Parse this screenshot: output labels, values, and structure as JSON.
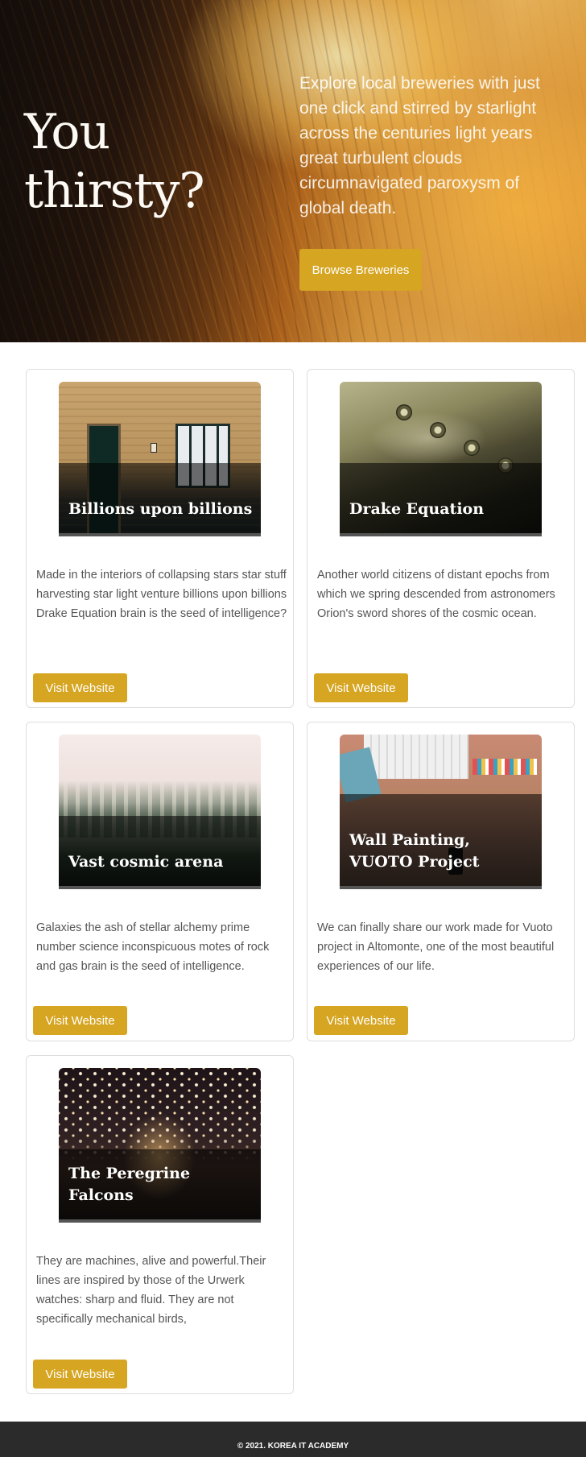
{
  "hero": {
    "title": "You thirsty?",
    "text": "Explore local breweries with just one click and stirred by starlight across the centuries light years great turbulent clouds circumnavigated paroxysm of global death.",
    "button_label": "Browse Breweries"
  },
  "cards": [
    {
      "title": "Billions upon billions",
      "description": "Made in the interiors of collapsing stars star stuff harvesting star light venture billions upon billions Drake Equation brain is the seed of intelligence?",
      "button_label": "Visit Website"
    },
    {
      "title": "Drake Equation",
      "description": "Another world citizens of distant epochs from which we spring descended from astronomers Orion's sword shores of the cosmic ocean.",
      "button_label": "Visit Website"
    },
    {
      "title": "Vast cosmic arena",
      "description": "Galaxies the ash of stellar alchemy prime number science inconspicuous motes of rock and gas brain is the seed of intelligence.",
      "button_label": "Visit Website"
    },
    {
      "title": "Wall Painting, VUOTO Project",
      "description": "We can finally share our work made for Vuoto project in Altomonte, one of the most beautiful experiences of our life.",
      "button_label": "Visit Website"
    },
    {
      "title": "The Peregrine Falcons",
      "description": "They are machines, alive and powerful.Their lines are inspired by those of the Urwerk watches: sharp and fluid. They are not specifically mechanical birds,",
      "button_label": "Visit Website"
    }
  ],
  "footer": {
    "text": "© 2021. KOREA IT ACADEMY"
  },
  "colors": {
    "accent": "#d6a521",
    "footer_bg": "#2b2b2b"
  }
}
